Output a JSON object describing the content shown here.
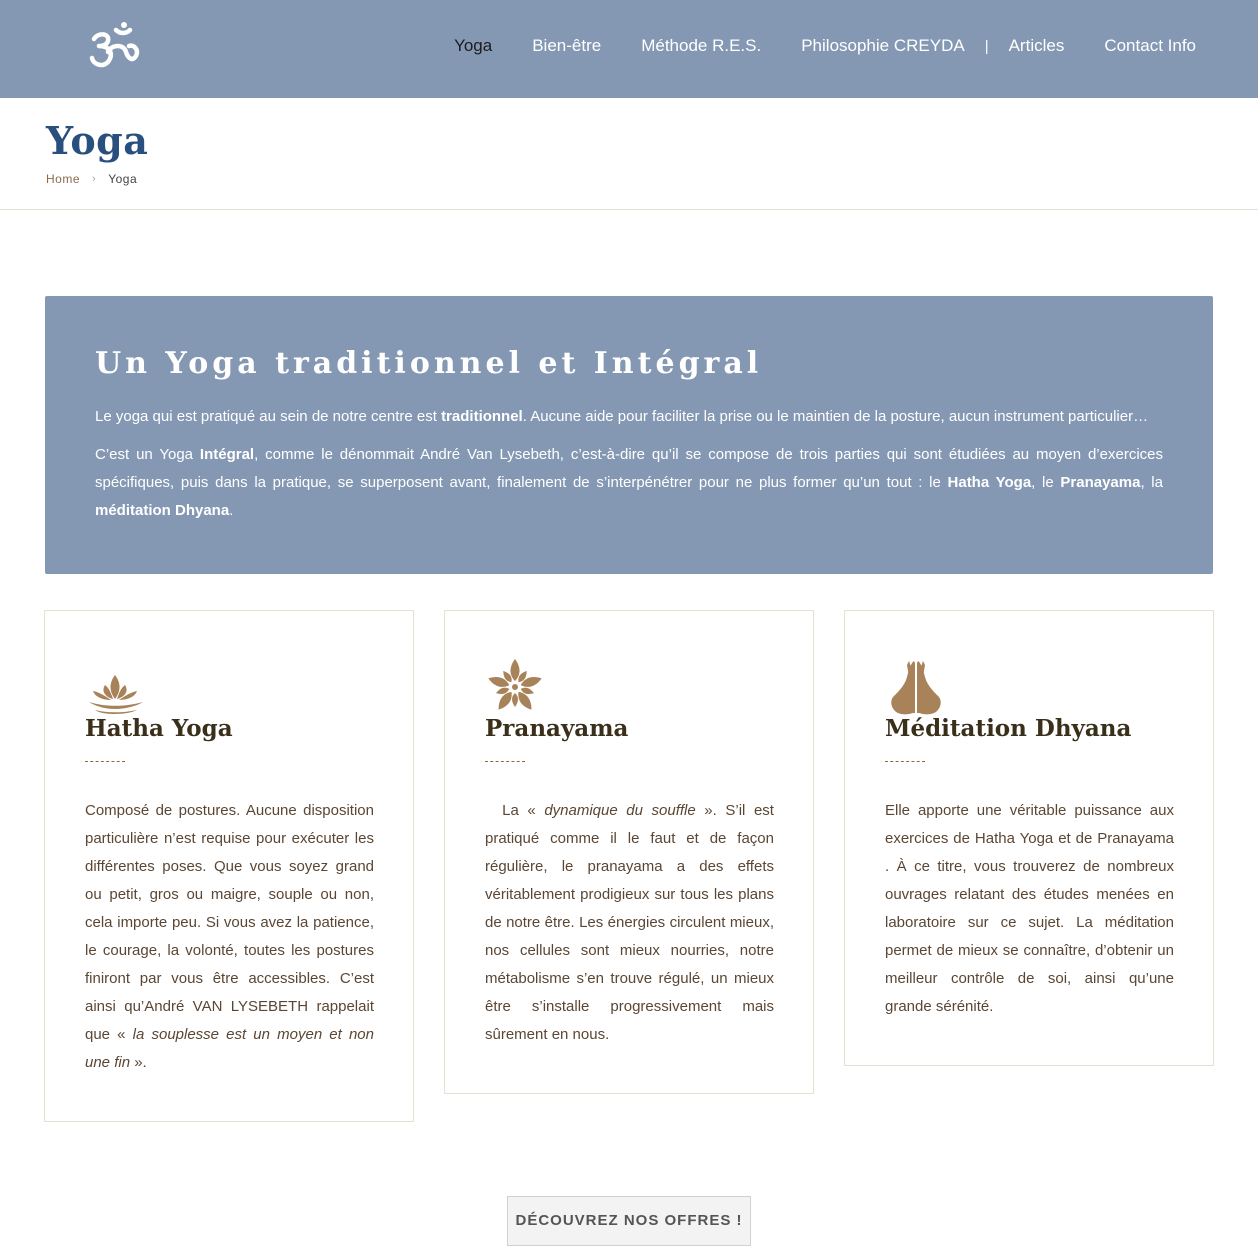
{
  "header": {
    "logo_icon": "om-symbol-icon",
    "nav": [
      {
        "label": "Yoga",
        "active": true
      },
      {
        "label": "Bien-être"
      },
      {
        "label": "Méthode R.E.S."
      },
      {
        "label": "Philosophie CREYDA"
      },
      {
        "label": "Articles"
      },
      {
        "label": "Contact Info"
      }
    ],
    "separator": "|"
  },
  "page": {
    "title": "Yoga",
    "breadcrumb": {
      "home": "Home",
      "separator": "›",
      "current": "Yoga"
    }
  },
  "intro": {
    "title": "Un Yoga traditionnel et Intégral",
    "p1_before": "Le yoga qui est pratiqué au sein de notre centre est ",
    "p1_bold": "traditionnel",
    "p1_after": ". Aucune aide pour faciliter la prise ou le maintien de la posture, aucun instrument particulier…",
    "p2_a": "C’est un Yoga ",
    "p2_b": "Intégral",
    "p2_c": ", comme le dénommait André Van Lysebeth, c’est-à-dire qu’il se compose de trois parties qui sont étudiées au moyen d’exercices spécifiques, puis dans la pratique, se superposent avant, finalement de s’interpénétrer pour ne plus former qu’un tout : le ",
    "p2_d": "Hatha Yoga",
    "p2_e": ", le ",
    "p2_f": "Pranayama",
    "p2_g": ", la ",
    "p2_h": "méditation Dhyana",
    "p2_i": "."
  },
  "cards": [
    {
      "icon": "lotus-icon",
      "title": "Hatha Yoga",
      "text_a": "Composé de postures. Aucune disposition particulière n’est requise pour exécuter les différentes poses. Que vous soyez grand ou petit, gros ou maigre, souple ou non, cela importe peu. Si vous avez la patience, le courage, la volonté, toutes les postures finiront par vous être accessibles. C’est ainsi qu’André VAN LYSEBETH rappelait que « ",
      "text_b": "la souplesse est un moyen et non une fin",
      "text_c": " »."
    },
    {
      "icon": "flower-icon",
      "title": "Pranayama",
      "text_a": "  La « ",
      "text_b": "dynamique du souffle",
      "text_c": " ». S’il est pratiqué comme il le faut et de façon régulière, le pranayama a des effets véritablement prodigieux sur tous les plans de notre être. Les énergies circulent mieux, nos cellules sont mieux nourries, notre métabolisme s’en trouve régulé, un mieux être s’installe progressivement mais sûrement en nous."
    },
    {
      "icon": "praying-hands-icon",
      "title": "Méditation Dhyana",
      "text_a": "Elle apporte une véritable puissance aux exercices de Hatha Yoga et de Pranayama . À ce titre, vous trouverez de nombreux ouvrages relatant des études menées en laboratoire sur ce sujet. La méditation permet de mieux se connaître, d’obtenir un meilleur contrôle de soi, ainsi qu’une grande sérénité.",
      "text_b": "",
      "text_c": ""
    }
  ],
  "cta": {
    "label": "DÉCOUVREZ NOS OFFRES !"
  },
  "colors": {
    "header_bg": "#8498b3",
    "title_blue": "#284f7e",
    "accent_gold": "#a8835a"
  }
}
